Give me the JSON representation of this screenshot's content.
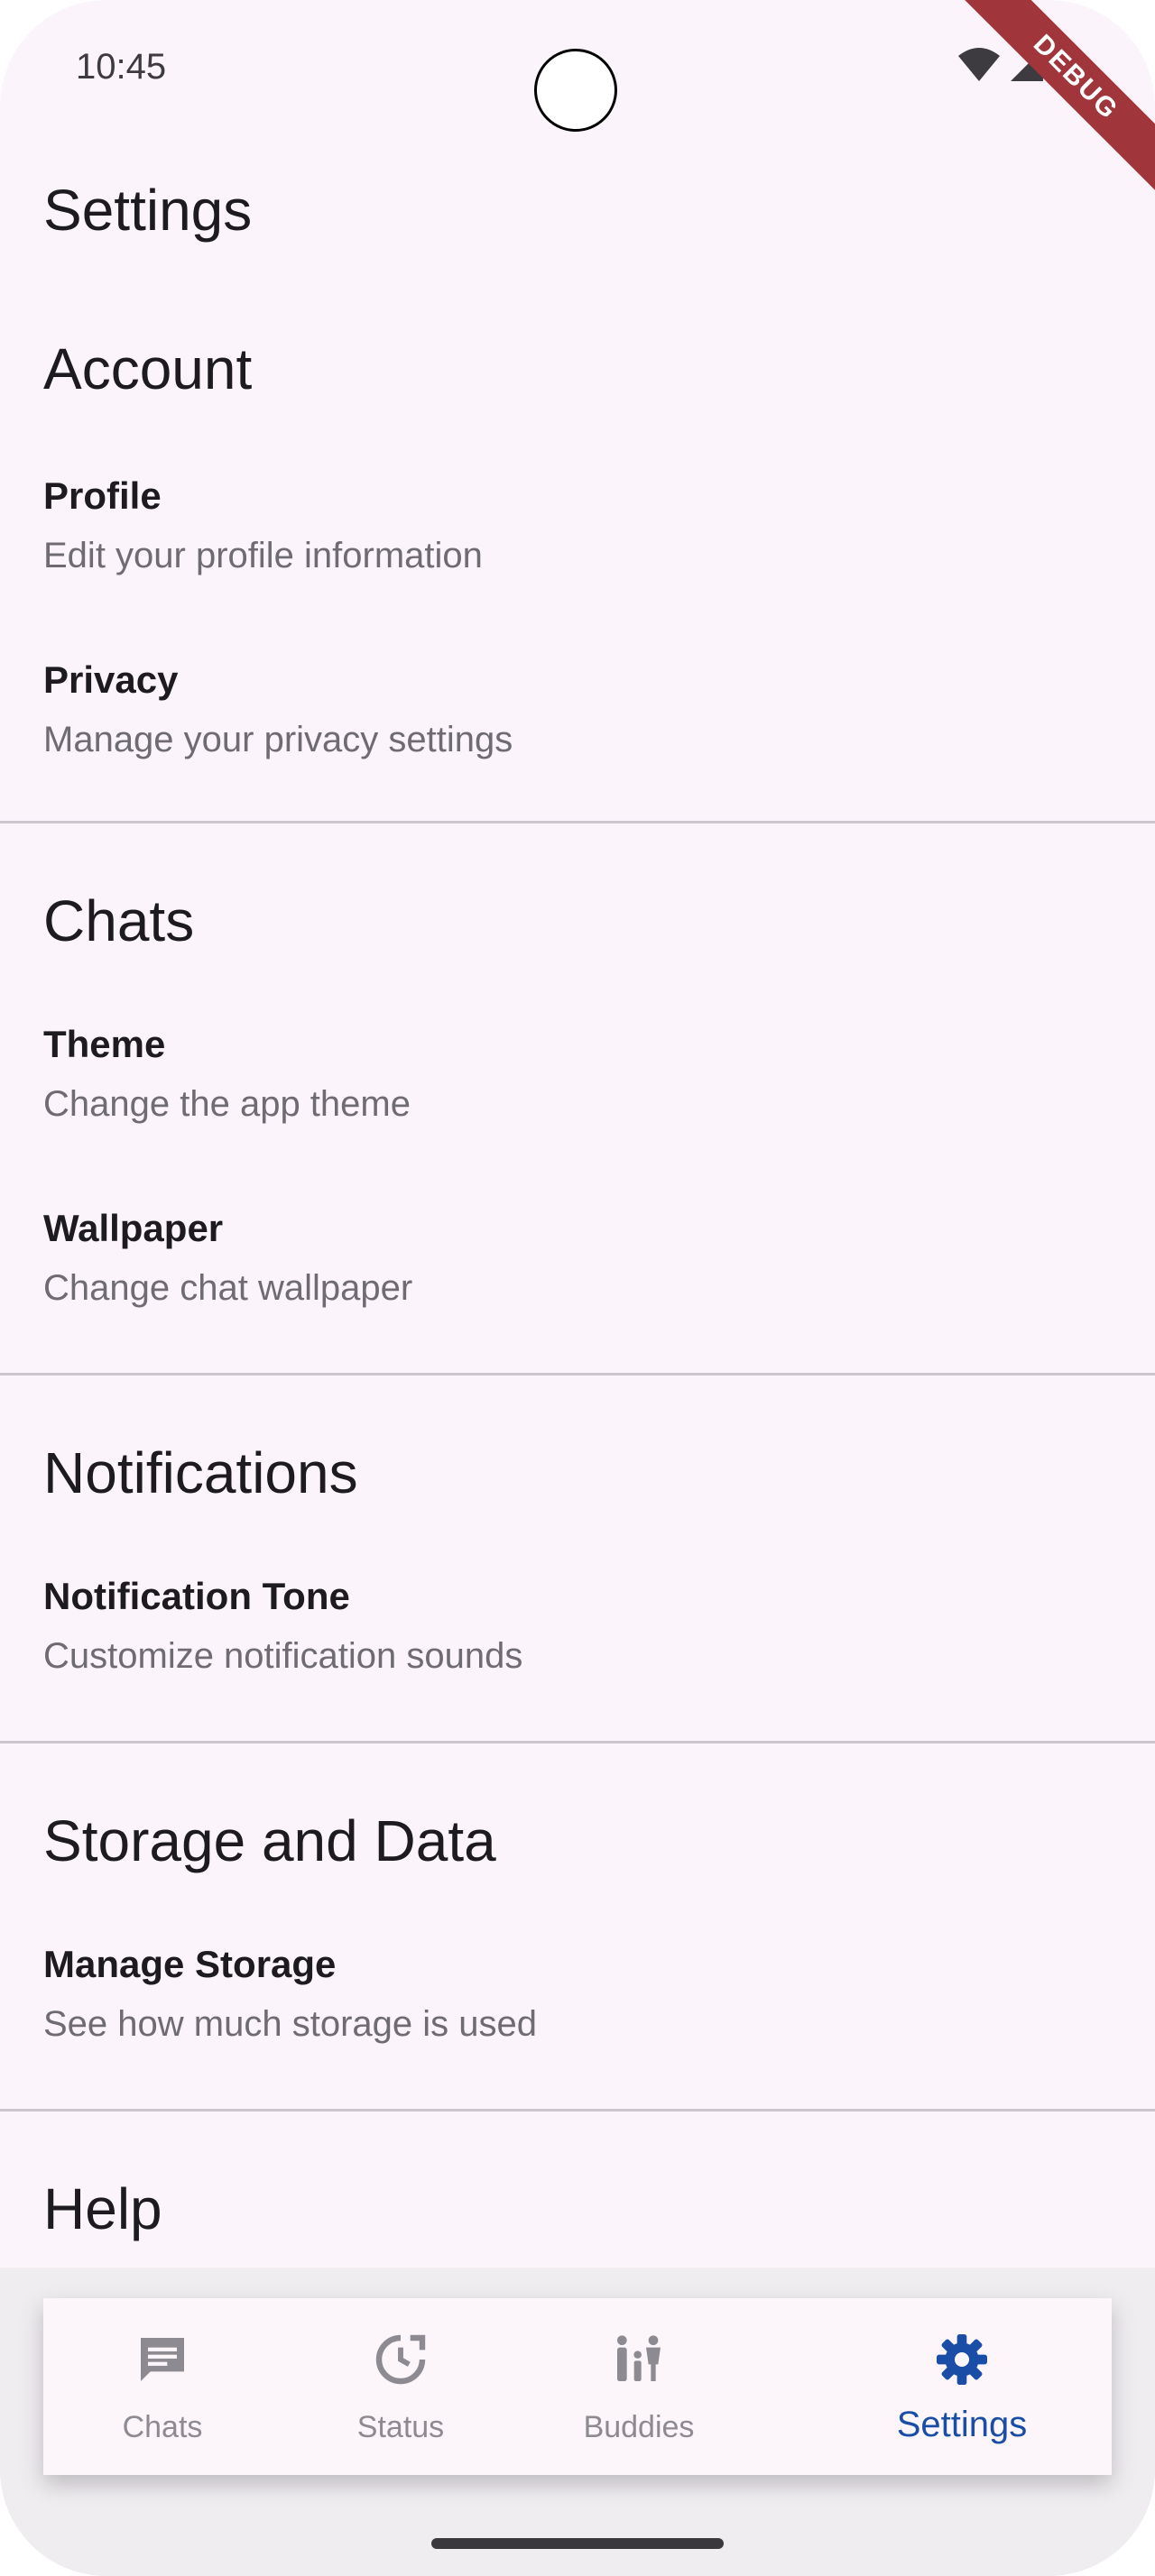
{
  "status_bar": {
    "time": "10:45",
    "debug_label": "DEBUG",
    "icons": [
      "wifi-icon",
      "signal-icon",
      "battery-icon"
    ]
  },
  "page": {
    "title": "Settings"
  },
  "sections": [
    {
      "header": "Account",
      "items": [
        {
          "title": "Profile",
          "subtitle": "Edit your profile information"
        },
        {
          "title": "Privacy",
          "subtitle": "Manage your privacy settings"
        }
      ]
    },
    {
      "header": "Chats",
      "items": [
        {
          "title": "Theme",
          "subtitle": "Change the app theme"
        },
        {
          "title": "Wallpaper",
          "subtitle": "Change chat wallpaper"
        }
      ]
    },
    {
      "header": "Notifications",
      "items": [
        {
          "title": "Notification Tone",
          "subtitle": "Customize notification sounds"
        }
      ]
    },
    {
      "header": "Storage and Data",
      "items": [
        {
          "title": "Manage Storage",
          "subtitle": "See how much storage is used"
        }
      ]
    },
    {
      "header": "Help",
      "items": []
    }
  ],
  "bottom_nav": {
    "active": "Settings",
    "items": [
      {
        "label": "Chats",
        "icon": "chat-icon"
      },
      {
        "label": "Status",
        "icon": "status-icon"
      },
      {
        "label": "Buddies",
        "icon": "buddies-icon"
      },
      {
        "label": "Settings",
        "icon": "gear-icon"
      }
    ]
  },
  "colors": {
    "background": "#fcf4fb",
    "accent": "#1a4ea6",
    "muted": "#8e8a91",
    "debug_banner": "#a0353b"
  }
}
